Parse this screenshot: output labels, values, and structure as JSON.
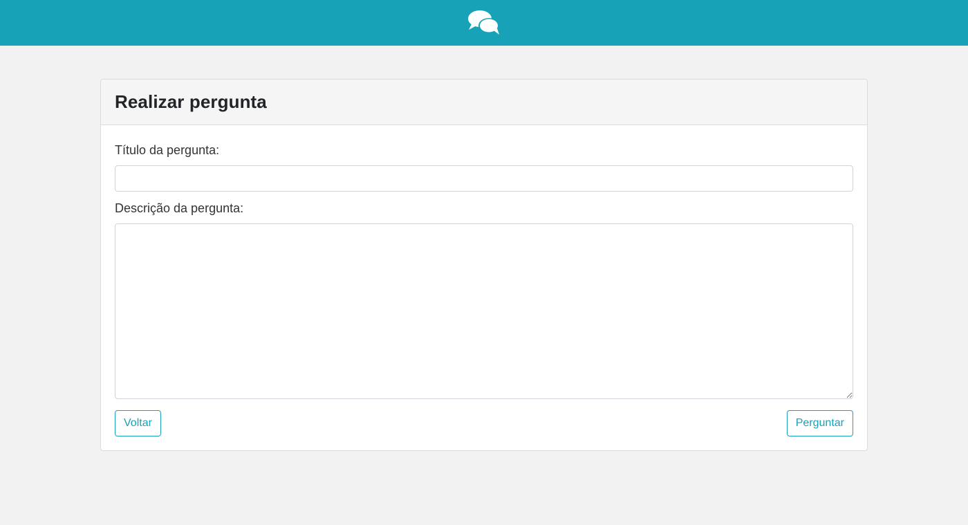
{
  "header": {
    "logo_icon": "comments-icon",
    "bar_color": "#17a2b8"
  },
  "card": {
    "title": "Realizar pergunta"
  },
  "form": {
    "title_label": "Título da pergunta:",
    "title_value": "",
    "description_label": "Descrição da pergunta:",
    "description_value": ""
  },
  "buttons": {
    "back_label": "Voltar",
    "submit_label": "Perguntar",
    "accent_color": "#17a2b8"
  }
}
